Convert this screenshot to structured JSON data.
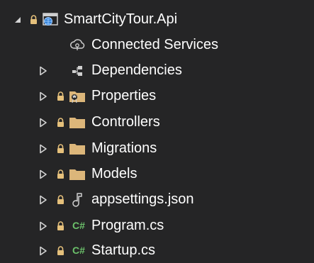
{
  "solution_explorer": {
    "project": {
      "label": "SmartCityTour.Api",
      "icon": "web-project-icon",
      "expanded": true
    },
    "items": [
      {
        "label": "Connected Services",
        "icon": "connected-services-icon"
      },
      {
        "label": "Dependencies",
        "icon": "dependencies-icon"
      },
      {
        "label": "Properties",
        "icon": "properties-folder-icon"
      },
      {
        "label": "Controllers",
        "icon": "folder-icon"
      },
      {
        "label": "Migrations",
        "icon": "folder-icon"
      },
      {
        "label": "Models",
        "icon": "folder-icon"
      },
      {
        "label": "appsettings.json",
        "icon": "json-file-icon"
      },
      {
        "label": "Program.cs",
        "icon": "csharp-file-icon",
        "badge": "C#"
      },
      {
        "label": "Startup.cs",
        "icon": "csharp-file-icon",
        "badge": "C#"
      }
    ]
  },
  "colors": {
    "background": "#252526",
    "text": "#ffffff",
    "caret": "#d4d4d4",
    "lock": "#e5c07b",
    "folder": "#dcb67a",
    "csharp": "#6cc26b"
  }
}
